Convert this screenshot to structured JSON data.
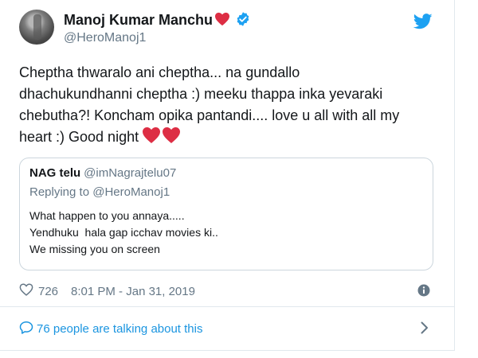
{
  "author": {
    "name": "Manoj Kumar Manchu",
    "handle": "@HeroManoj1"
  },
  "tweet": {
    "lines": [
      "Cheptha thwaralo ani cheptha... na gundallo",
      "dhachukundhanni cheptha :) meeku thappa inka yevaraki",
      "chebutha?! Koncham opika pantandi.... love u all with all my",
      "heart :) Good night"
    ]
  },
  "quoted": {
    "name": "NAG telu",
    "handle": "@imNagrajtelu07",
    "replying_prefix": "Replying to",
    "replying_to": "@HeroManoj1",
    "lines": [
      "What happen to you annaya.....",
      "Yendhuku  hala gap icchav movies ki..",
      "We missing you on screen"
    ]
  },
  "meta": {
    "likes": "726",
    "timestamp": "8:01 PM - Jan 31, 2019"
  },
  "conversation": {
    "label": "76 people are talking about this"
  },
  "colors": {
    "twitter_blue": "#1da1f2",
    "link_blue": "#1b95e0",
    "heart_red": "#e0245e",
    "muted": "#657786"
  },
  "icons": {
    "verified": "verified-badge-icon",
    "twitter": "twitter-bird-icon",
    "heart": "heart-icon",
    "info": "info-icon",
    "comment": "comment-bubble-icon",
    "chevron": "chevron-right-icon"
  }
}
